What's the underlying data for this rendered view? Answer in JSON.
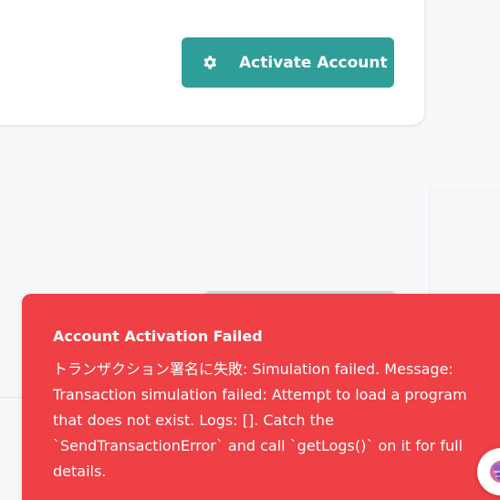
{
  "account_panel": {
    "activate_label": "Activate Account",
    "button_color": "#2f9e98",
    "button_icon": "gear-icon"
  },
  "toast": {
    "title": "Account Activation Failed",
    "message": "トランザクション署名に失敗: Simulation failed. Message: Transaction simulation failed: Attempt to load a program that does not exist. Logs: []. Catch the `SendTransactionError` and call `getLogs()` on it for full details.",
    "background": "#ee4045"
  },
  "assistant": {
    "icon": "assistant-avatar-icon"
  }
}
